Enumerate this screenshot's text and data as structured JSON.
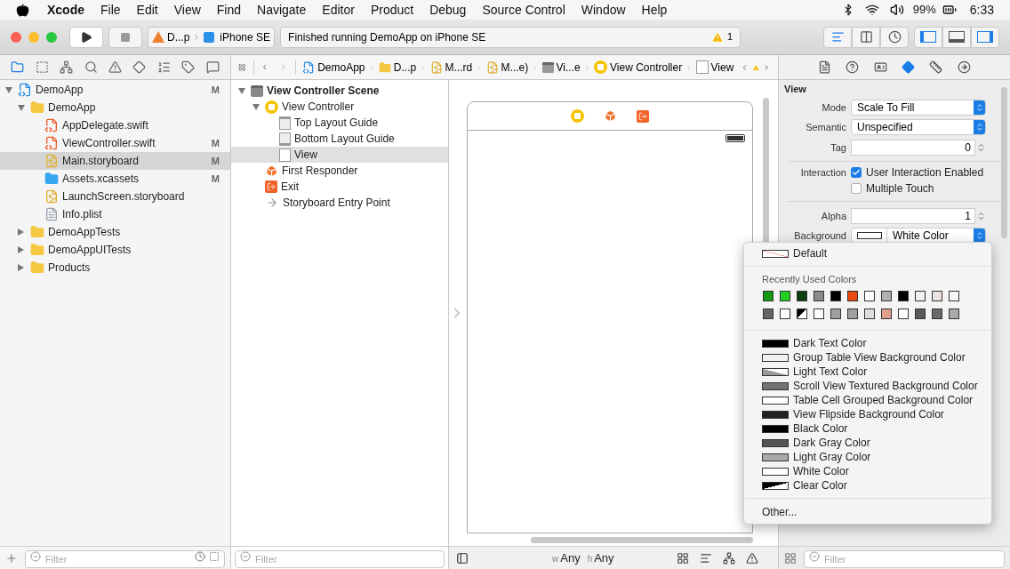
{
  "menu_bar": {
    "app": "Xcode",
    "items": [
      "File",
      "Edit",
      "View",
      "Find",
      "Navigate",
      "Editor",
      "Product",
      "Debug",
      "Source Control",
      "Window",
      "Help"
    ],
    "battery_text": "99%",
    "clock": "6:33"
  },
  "toolbar": {
    "scheme": "D...p",
    "device": "iPhone SE",
    "activity": "Finished running DemoApp on iPhone SE",
    "warning_count": "1",
    "editor_buttons": [
      {
        "kind": "standard",
        "selected": true
      },
      {
        "kind": "assistant",
        "selected": false
      },
      {
        "kind": "version",
        "selected": false
      }
    ],
    "panel_buttons": [
      {
        "kind": "navigator",
        "selected": true
      },
      {
        "kind": "debug",
        "selected": false
      },
      {
        "kind": "utilities",
        "selected": true
      }
    ]
  },
  "navigator_tabs": [
    {
      "kind": "project",
      "selected": true
    },
    {
      "kind": "symbol",
      "selected": false
    },
    {
      "kind": "hierarchy",
      "selected": false
    },
    {
      "kind": "find",
      "selected": false
    },
    {
      "kind": "issue",
      "selected": false
    },
    {
      "kind": "test",
      "selected": false
    },
    {
      "kind": "debug",
      "selected": false
    },
    {
      "kind": "breakpoint",
      "selected": false
    },
    {
      "kind": "report",
      "selected": false
    }
  ],
  "jump_bar": [
    {
      "kind": "project",
      "label": "DemoApp"
    },
    {
      "kind": "folder",
      "label": "D...p"
    },
    {
      "kind": "storyboard",
      "label": "M...rd"
    },
    {
      "kind": "storyboard",
      "label": "M...e)"
    },
    {
      "kind": "scene",
      "label": "Vi...e"
    },
    {
      "kind": "controller",
      "label": "View Controller"
    },
    {
      "kind": "view",
      "label": "View"
    }
  ],
  "files": [
    {
      "kind": "project",
      "name": "DemoApp",
      "badge": "M",
      "expanded": true,
      "selected": false,
      "children": [
        {
          "kind": "folder",
          "name": "DemoApp",
          "expanded": true,
          "selected": false,
          "children": [
            {
              "kind": "swift",
              "name": "AppDelegate.swift",
              "selected": false
            },
            {
              "kind": "swift",
              "name": "ViewController.swift",
              "badge": "M",
              "selected": false
            },
            {
              "kind": "storyboard",
              "name": "Main.storyboard",
              "badge": "M",
              "selected": true
            },
            {
              "kind": "assets",
              "name": "Assets.xcassets",
              "badge": "M",
              "selected": false
            },
            {
              "kind": "storyboard",
              "name": "LaunchScreen.storyboard",
              "selected": false
            },
            {
              "kind": "plist",
              "name": "Info.plist",
              "selected": false
            }
          ]
        },
        {
          "kind": "folder",
          "name": "DemoAppTests",
          "expanded": false,
          "selected": false
        },
        {
          "kind": "folder",
          "name": "DemoAppUITests",
          "expanded": false,
          "selected": false
        },
        {
          "kind": "folder",
          "name": "Products",
          "expanded": false,
          "selected": false
        }
      ]
    }
  ],
  "navigator_filter": {
    "placeholder": "Filter"
  },
  "outline": [
    {
      "kind": "scene",
      "name": "View Controller Scene",
      "expanded": true,
      "selected": false,
      "children": [
        {
          "kind": "controller",
          "name": "View Controller",
          "expanded": true,
          "selected": false,
          "children": [
            {
              "kind": "top_guide",
              "name": "Top Layout Guide",
              "selected": false
            },
            {
              "kind": "bottom_guide",
              "name": "Bottom Layout Guide",
              "selected": false
            },
            {
              "kind": "view",
              "name": "View",
              "selected": true
            }
          ]
        },
        {
          "kind": "responder",
          "name": "First Responder",
          "selected": false
        },
        {
          "kind": "exit",
          "name": "Exit",
          "selected": false
        },
        {
          "kind": "entry",
          "name": "Storyboard Entry Point",
          "selected": false
        }
      ]
    }
  ],
  "outline_filter": {
    "placeholder": "Filter"
  },
  "size_class": {
    "w_prefix": "w",
    "w_value": "Any",
    "h_prefix": "h",
    "h_value": "Any"
  },
  "inspector_tabs": [
    {
      "kind": "file",
      "selected": false
    },
    {
      "kind": "help",
      "selected": false
    },
    {
      "kind": "identity",
      "selected": false
    },
    {
      "kind": "attributes",
      "selected": true
    },
    {
      "kind": "size",
      "selected": false
    },
    {
      "kind": "connections",
      "selected": false
    }
  ],
  "inspector": {
    "section": "View",
    "mode": {
      "label": "Mode",
      "value": "Scale To Fill"
    },
    "semantic": {
      "label": "Semantic",
      "value": "Unspecified"
    },
    "tag": {
      "label": "Tag",
      "value": "0"
    },
    "interaction": {
      "label": "Interaction",
      "options": [
        {
          "label": "User Interaction Enabled",
          "checked": true
        },
        {
          "label": "Multiple Touch",
          "checked": false
        }
      ]
    },
    "alpha": {
      "label": "Alpha",
      "value": "1"
    },
    "background": {
      "label": "Background",
      "value": "White Color"
    }
  },
  "inspector_filter": {
    "placeholder": "Filter"
  },
  "color_menu": {
    "default_label": "Default",
    "recent_title": "Recently Used Colors",
    "recent_colors": [
      {
        "kind": "solid",
        "color": "#139a13"
      },
      {
        "kind": "solid",
        "color": "#22d022"
      },
      {
        "kind": "solid",
        "color": "#0e3e0e"
      },
      {
        "kind": "solid",
        "color": "#8a8a8a"
      },
      {
        "kind": "solid",
        "color": "#000000"
      },
      {
        "kind": "solid",
        "color": "#ec4a0e"
      },
      {
        "kind": "solid",
        "color": "#ffffff"
      },
      {
        "kind": "solid",
        "color": "#b0b0b0"
      },
      {
        "kind": "solid",
        "color": "#000000"
      },
      {
        "kind": "solid",
        "color": "#f0f0f0"
      },
      {
        "kind": "solid",
        "color": "#ece2de"
      },
      {
        "kind": "solid",
        "color": "#f6f6f6"
      },
      {
        "kind": "solid",
        "color": "#666666"
      },
      {
        "kind": "solid",
        "color": "#ffffff"
      },
      {
        "kind": "clear",
        "color": "#000000"
      },
      {
        "kind": "solid",
        "color": "#ffffff"
      },
      {
        "kind": "solid",
        "color": "#a0a0a0"
      },
      {
        "kind": "solid",
        "color": "#a0a0a0"
      },
      {
        "kind": "solid",
        "color": "#dddddd"
      },
      {
        "kind": "solid",
        "color": "#dca08c"
      },
      {
        "kind": "solid",
        "color": "#ffffff"
      },
      {
        "kind": "solid",
        "color": "#5a5a5a"
      },
      {
        "kind": "solid",
        "color": "#6a6a6a"
      },
      {
        "kind": "solid",
        "color": "#aaaaaa"
      }
    ],
    "named_colors": [
      {
        "kind": "solid",
        "color": "#000000",
        "label": "Dark Text Color"
      },
      {
        "kind": "solid",
        "color": "#f2f2f2",
        "label": "Group Table View Background Color"
      },
      {
        "kind": "split",
        "color": "#999999",
        "label": "Light Text Color"
      },
      {
        "kind": "solid",
        "color": "#737373",
        "label": "Scroll View Textured Background Color"
      },
      {
        "kind": "solid",
        "color": "#ffffff",
        "label": "Table Cell Grouped Background Color"
      },
      {
        "kind": "solid",
        "color": "#1f2123",
        "label": "View Flipside Background Color"
      },
      {
        "kind": "solid",
        "color": "#000000",
        "label": "Black Color"
      },
      {
        "kind": "solid",
        "color": "#555555",
        "label": "Dark Gray Color"
      },
      {
        "kind": "solid",
        "color": "#aaaaaa",
        "label": "Light Gray Color"
      },
      {
        "kind": "solid",
        "color": "#ffffff",
        "label": "White Color"
      },
      {
        "kind": "clear",
        "color": "#000000",
        "label": "Clear Color"
      }
    ],
    "other_label": "Other..."
  }
}
